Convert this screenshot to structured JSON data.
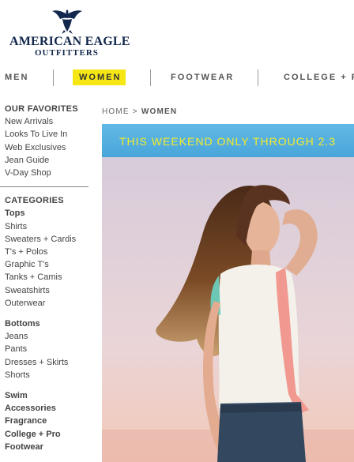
{
  "brand": {
    "line1": "AMERICAN EAGLE",
    "line2": "OUTFITTERS",
    "color": "#12284c"
  },
  "topnav": {
    "items": [
      {
        "label": "MEN"
      },
      {
        "label": "WOMEN",
        "active": true
      },
      {
        "label": "FOOTWEAR"
      },
      {
        "label": "COLLEGE + P"
      }
    ],
    "active_color": "#f6e714"
  },
  "breadcrumb": {
    "home": "HOME",
    "separator": ">",
    "current": "WOMEN"
  },
  "banner": {
    "text": "THIS WEEKEND ONLY THROUGH 2.3",
    "bg_color": "#4aa6d9",
    "text_color": "#f7eb2a"
  },
  "sidebar": {
    "favorites_heading": "OUR FAVORITES",
    "favorites": [
      "New Arrivals",
      "Looks To Live In",
      "Web Exclusives",
      "Jean Guide",
      "V-Day Shop"
    ],
    "categories_heading": "CATEGORIES",
    "tops": [
      "Tops",
      "Shirts",
      "Sweaters + Cardis",
      "T's + Polos",
      "Graphic T's",
      "Tanks + Camis",
      "Sweatshirts",
      "Outerwear"
    ],
    "bottoms": [
      "Bottoms",
      "Jeans",
      "Pants",
      "Dresses + Skirts",
      "Shorts"
    ],
    "more": [
      "Swim",
      "Accessories",
      "Fragrance",
      "College + Pro",
      "Footwear"
    ]
  },
  "hero": {
    "description_icon": "model-photo"
  }
}
